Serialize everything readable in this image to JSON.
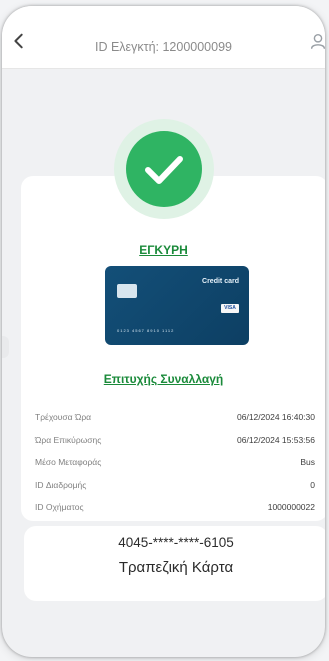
{
  "header": {
    "title": "ID Ελεγκτή: 1200000099",
    "back_icon": "chevron-left-icon",
    "user_icon": "user-icon"
  },
  "validation": {
    "status": "ΕΓΚΥΡΗ",
    "status_color": "#1a8a3a",
    "check_color": "#2fb463"
  },
  "credit_card_image": {
    "label": "Credit card",
    "brand": "VISA",
    "number_hint": "0123 4567 8910 1112"
  },
  "transaction": {
    "title": "Επιτυχής Συναλλαγή",
    "details": [
      {
        "label": "Τρέχουσα Ώρα",
        "value": "06/12/2024 16:40:30"
      },
      {
        "label": "Ώρα Επικύρωσης",
        "value": "06/12/2024 15:53:56"
      },
      {
        "label": "Μέσο Μεταφοράς",
        "value": "Bus"
      },
      {
        "label": "ID Διαδρομής",
        "value": "0"
      },
      {
        "label": "ID Οχήματος",
        "value": "1000000022"
      }
    ]
  },
  "payment": {
    "pan": "4045-****-****-6105",
    "type": "Τραπεζική Κάρτα"
  }
}
